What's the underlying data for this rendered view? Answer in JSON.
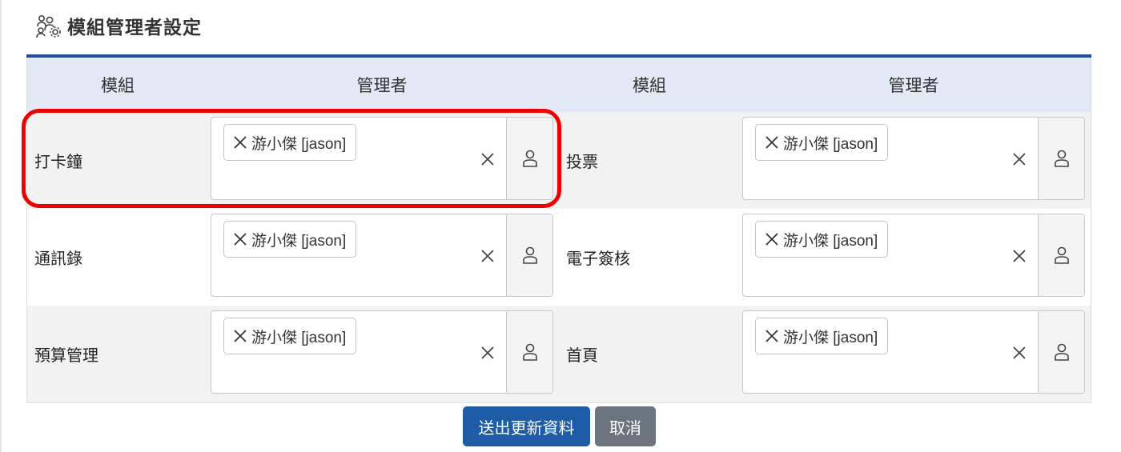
{
  "header": {
    "title": "模組管理者設定",
    "icon": "user-group-gear-icon"
  },
  "table": {
    "columns": [
      "模組",
      "管理者",
      "模組",
      "管理者"
    ],
    "rows": [
      {
        "left": {
          "module": "打卡鐘",
          "admin": "游小傑 [jason]"
        },
        "right": {
          "module": "投票",
          "admin": "游小傑 [jason]"
        }
      },
      {
        "left": {
          "module": "通訊錄",
          "admin": "游小傑 [jason]"
        },
        "right": {
          "module": "電子簽核",
          "admin": "游小傑 [jason]"
        }
      },
      {
        "left": {
          "module": "預算管理",
          "admin": "游小傑 [jason]"
        },
        "right": {
          "module": "首頁",
          "admin": "游小傑 [jason]"
        }
      }
    ]
  },
  "buttons": {
    "submit": "送出更新資料",
    "cancel": "取消"
  },
  "colors": {
    "accent": "#1f4e9c",
    "primary_button": "#1f5ca8",
    "secondary_button": "#6c757d",
    "highlight": "#ee0000"
  }
}
